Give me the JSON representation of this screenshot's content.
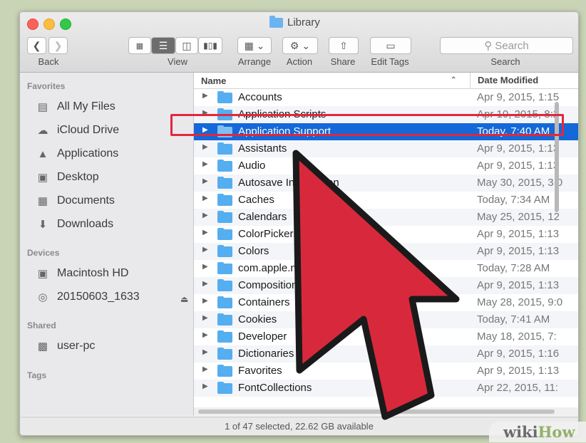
{
  "window": {
    "title": "Library"
  },
  "toolbar": {
    "back_label": "Back",
    "view_label": "View",
    "arrange_label": "Arrange",
    "action_label": "Action",
    "share_label": "Share",
    "edit_tags_label": "Edit Tags",
    "search_placeholder": "Search",
    "search_label": "Search"
  },
  "sidebar": {
    "favorites_header": "Favorites",
    "favorites": [
      {
        "label": "All My Files",
        "icon": "all-files-icon"
      },
      {
        "label": "iCloud Drive",
        "icon": "cloud-icon"
      },
      {
        "label": "Applications",
        "icon": "applications-icon"
      },
      {
        "label": "Desktop",
        "icon": "desktop-icon"
      },
      {
        "label": "Documents",
        "icon": "documents-icon"
      },
      {
        "label": "Downloads",
        "icon": "download-icon"
      }
    ],
    "devices_header": "Devices",
    "devices": [
      {
        "label": "Macintosh HD",
        "icon": "hard-drive-icon"
      },
      {
        "label": "20150603_1633",
        "icon": "disc-icon"
      }
    ],
    "shared_header": "Shared",
    "shared": [
      {
        "label": "user-pc",
        "icon": "computer-icon"
      }
    ],
    "tags_header": "Tags"
  },
  "file_list": {
    "columns": {
      "name": "Name",
      "date": "Date Modified"
    },
    "rows": [
      {
        "name": "Accounts",
        "date": "Apr 9, 2015, 1:15"
      },
      {
        "name": "Application Scripts",
        "date": "Apr 10, 2015, 8:2"
      },
      {
        "name": "Application Support",
        "date": "Today, 7:40 AM",
        "selected": true
      },
      {
        "name": "Assistants",
        "date": "Apr 9, 2015, 1:13"
      },
      {
        "name": "Audio",
        "date": "Apr 9, 2015, 1:13"
      },
      {
        "name": "Autosave Information",
        "date": "May 30, 2015, 3:0"
      },
      {
        "name": "Caches",
        "date": "Today, 7:34 AM"
      },
      {
        "name": "Calendars",
        "date": "May 25, 2015, 12"
      },
      {
        "name": "ColorPickers",
        "date": "Apr 9, 2015, 1:13"
      },
      {
        "name": "Colors",
        "date": "Apr 9, 2015, 1:13"
      },
      {
        "name": "com.apple.nsurlsessiond",
        "date": "Today, 7:28 AM"
      },
      {
        "name": "Compositions",
        "date": "Apr 9, 2015, 1:13"
      },
      {
        "name": "Containers",
        "date": "May 28, 2015, 9:0"
      },
      {
        "name": "Cookies",
        "date": "Today, 7:41 AM"
      },
      {
        "name": "Developer",
        "date": "May 18, 2015, 7:"
      },
      {
        "name": "Dictionaries",
        "date": "Apr 9, 2015, 1:16"
      },
      {
        "name": "Favorites",
        "date": "Apr 9, 2015, 1:13"
      },
      {
        "name": "FontCollections",
        "date": "Apr 22, 2015, 11:"
      }
    ]
  },
  "status_bar": {
    "text": "1 of 47 selected, 22.62 GB available"
  },
  "watermark": {
    "wiki": "wiki",
    "how": "How"
  },
  "colors": {
    "selection": "#1468d8",
    "highlight_box": "#e0283c",
    "arrow_fill": "#d8293c",
    "folder": "#54aef0"
  }
}
